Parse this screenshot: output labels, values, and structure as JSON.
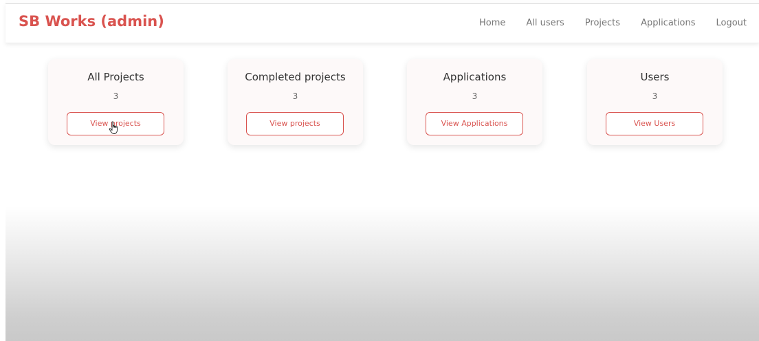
{
  "navbar": {
    "brand": "SB Works (admin)",
    "links": [
      "Home",
      "All users",
      "Projects",
      "Applications",
      "Logout"
    ]
  },
  "cards": [
    {
      "title": "All Projects",
      "count": "3",
      "button": "View projects"
    },
    {
      "title": "Completed projects",
      "count": "3",
      "button": "View projects"
    },
    {
      "title": "Applications",
      "count": "3",
      "button": "View Applications"
    },
    {
      "title": "Users",
      "count": "3",
      "button": "View Users"
    }
  ],
  "colors": {
    "accent": "#d9534f",
    "card_bg": "#fdf9f9",
    "nav_text": "#777777"
  },
  "icons": {
    "cursor": "hand-pointer-icon"
  }
}
